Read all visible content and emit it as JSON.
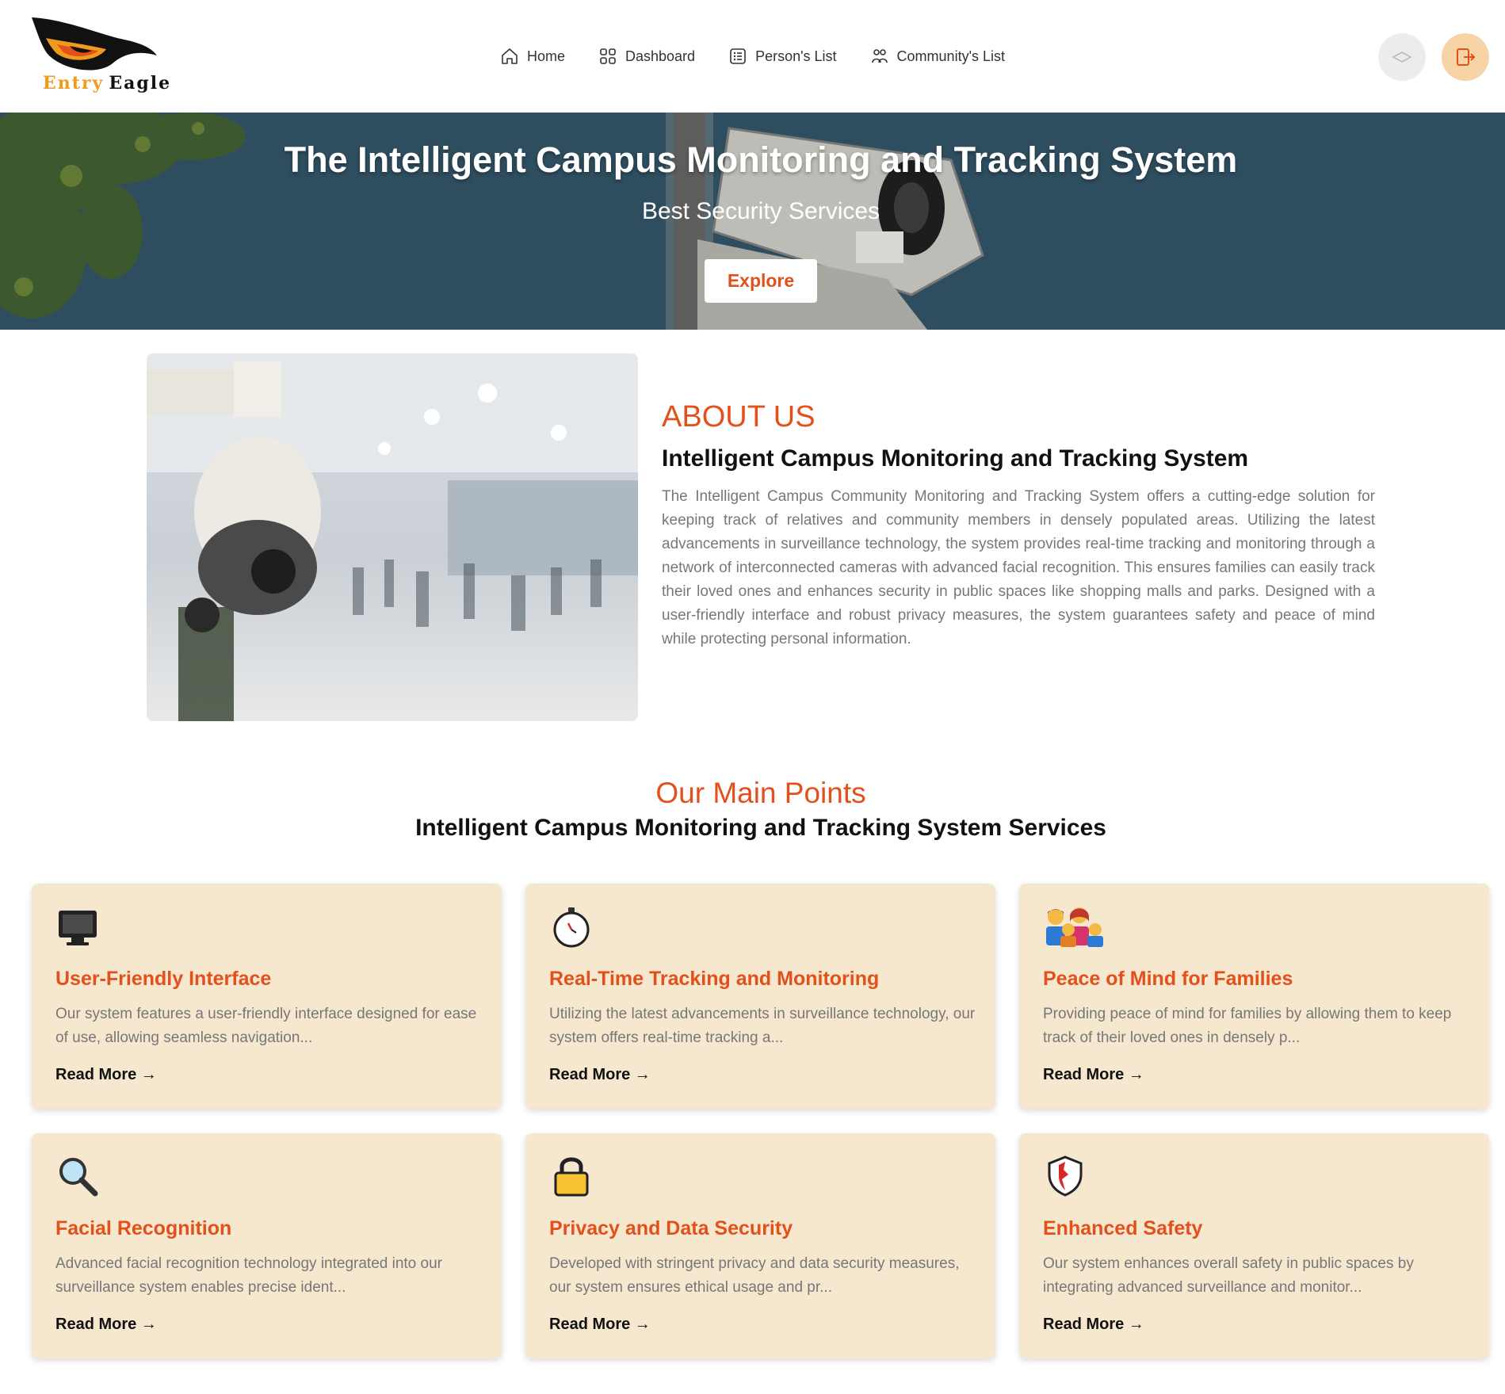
{
  "brand": {
    "logo_word1": "Entry",
    "logo_word2": "Eagle"
  },
  "nav": {
    "items": [
      {
        "label": "Home",
        "icon": "home-icon"
      },
      {
        "label": "Dashboard",
        "icon": "dashboard-grid-icon"
      },
      {
        "label": "Person's List",
        "icon": "list-icon"
      },
      {
        "label": "Community's List",
        "icon": "people-icon"
      }
    ],
    "theme_icon": "theme-toggle-icon",
    "logout_icon": "logout-icon"
  },
  "hero": {
    "title": "The Intelligent Campus Monitoring and Tracking System",
    "subtitle": "Best Security Services",
    "button": "Explore"
  },
  "about": {
    "kicker": "ABOUT US",
    "title": "Intelligent Campus Monitoring and Tracking System",
    "text": "The Intelligent Campus Community Monitoring and Tracking System offers a cutting-edge solution for keeping track of relatives and community members in densely populated areas. Utilizing the latest advancements in surveillance technology, the system provides real-time tracking and monitoring through a network of interconnected cameras with advanced facial recognition. This ensures families can easily track their loved ones and enhances security in public spaces like shopping malls and parks. Designed with a user-friendly interface and robust privacy measures, the system guarantees safety and peace of mind while protecting personal information."
  },
  "points": {
    "kicker": "Our Main Points",
    "title": "Intelligent Campus Monitoring and Tracking System Services",
    "cards": [
      {
        "icon": "monitor-icon",
        "title": "User-Friendly Interface",
        "text": "Our system features a user-friendly interface designed for ease of use, allowing seamless navigation...",
        "more": "Read More →"
      },
      {
        "icon": "stopwatch-icon",
        "title": "Real-Time Tracking and Monitoring",
        "text": "Utilizing the latest advancements in surveillance technology, our system offers real-time tracking a...",
        "more": "Read More →"
      },
      {
        "icon": "family-icon",
        "title": "Peace of Mind for Families",
        "text": "Providing peace of mind for families by allowing them to keep track of their loved ones in densely p...",
        "more": "Read More →"
      },
      {
        "icon": "magnifier-icon",
        "title": "Facial Recognition",
        "text": "Advanced facial recognition technology integrated into our surveillance system enables precise ident...",
        "more": "Read More →"
      },
      {
        "icon": "lock-icon",
        "title": "Privacy and Data Security",
        "text": "Developed with stringent privacy and data security measures, our system ensures ethical usage and pr...",
        "more": "Read More →"
      },
      {
        "icon": "shield-icon",
        "title": "Enhanced Safety",
        "text": "Our system enhances overall safety in public spaces by integrating advanced surveillance and monitor...",
        "more": "Read More →"
      }
    ]
  },
  "colors": {
    "accent": "#e2501b",
    "card_bg": "#f6e7cf",
    "hero_bg": "#2e4d5e",
    "logout_bg": "#f7d3a5"
  }
}
